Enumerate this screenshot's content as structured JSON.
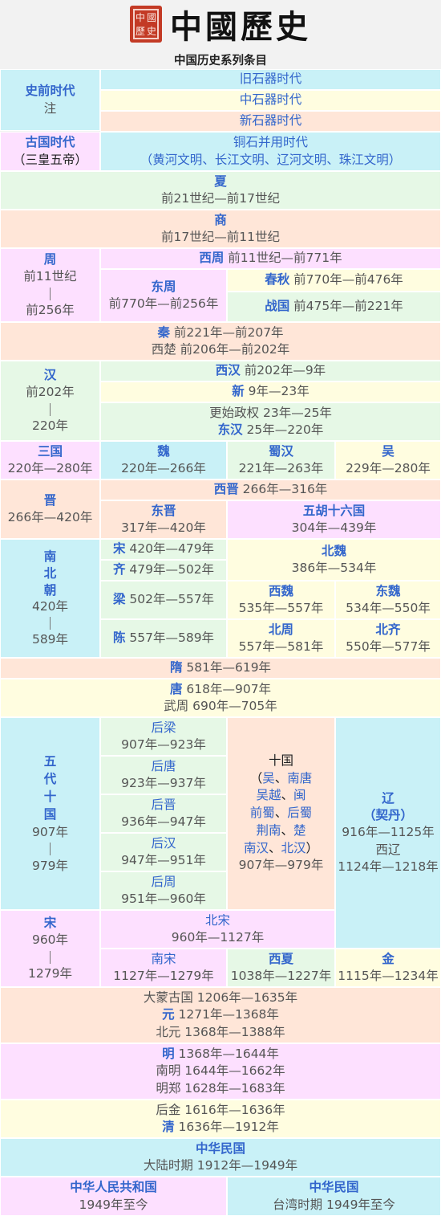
{
  "title": "中國歷史",
  "seal": [
    "中",
    "國",
    "歷",
    "史"
  ],
  "subtitle": "中国历史系列条目",
  "cells": {
    "c_prehist": [
      "史前时代",
      "注"
    ],
    "c_paleo": [
      "旧石器时代"
    ],
    "c_meso": [
      "中石器时代"
    ],
    "c_neo": [
      "新石器时代"
    ],
    "c_ancient": [
      "古国时代",
      "（三皇五帝）"
    ],
    "c_chalco": [
      "铜石并用时代",
      "（黄河文明、长江文明、辽河文明、珠江文明）"
    ],
    "c_xia": [
      "夏",
      "前21世纪—前17世纪"
    ],
    "c_shang": [
      "商",
      "前17世纪—前11世纪"
    ],
    "c_zhou": [
      "周",
      "前11世纪",
      "前256年"
    ],
    "c_xizhou": [
      "西周",
      " 前11世纪—前771年"
    ],
    "c_dongzhou": [
      "东周",
      "前770年—前256年"
    ],
    "c_chunqiu": [
      "春秋",
      " 前770年—前476年"
    ],
    "c_zhanguo": [
      "战国",
      " 前475年—前221年"
    ],
    "c_qin": [
      "秦",
      " 前221年—前207年",
      "西楚 前206年—前202年"
    ],
    "c_han": [
      "汉",
      "前202年",
      "220年"
    ],
    "c_xihan": [
      "西汉",
      " 前202年—9年"
    ],
    "c_xin": [
      "新",
      " 9年—23年"
    ],
    "c_gengshi": [
      "更始政权 23年—25年"
    ],
    "c_donghan": [
      "东汉",
      " 25年—220年"
    ],
    "c_sanguo": [
      "三国",
      "220年—280年"
    ],
    "c_wei": [
      "魏",
      "220年—266年"
    ],
    "c_shuhan": [
      "蜀汉",
      "221年—263年"
    ],
    "c_wu": [
      "吴",
      "229年—280年"
    ],
    "c_jin": [
      "晋",
      "266年—420年"
    ],
    "c_xijin": [
      "西晋",
      " 266年—316年"
    ],
    "c_dongjin": [
      "东晋",
      "317年—420年"
    ],
    "c_wuhu": [
      "五胡十六国",
      "304年—439年"
    ],
    "c_nanbei": [
      "南",
      "北",
      "朝",
      "420年",
      "589年"
    ],
    "c_song420": [
      "宋",
      " 420年—479年"
    ],
    "c_qi479": [
      "齐",
      " 479年—502年"
    ],
    "c_liang502": [
      "梁",
      " 502年—557年"
    ],
    "c_chen557": [
      "陈",
      " 557年—589年"
    ],
    "c_beiwei": [
      "北魏",
      "386年—534年"
    ],
    "c_xiwei": [
      "西魏",
      "535年—557年"
    ],
    "c_dongwei": [
      "东魏",
      "534年—550年"
    ],
    "c_beizhou": [
      "北周",
      "557年—581年"
    ],
    "c_beiqi": [
      "北齐",
      "550年—577年"
    ],
    "c_sui": [
      "隋",
      " 581年—619年"
    ],
    "c_tang": [
      "唐",
      " 618年—907年",
      "武周 690年—705年"
    ],
    "c_wudai": [
      "五",
      "代",
      "十",
      "国",
      "907年",
      "979年"
    ],
    "c_houliang": [
      "后梁",
      "907年—923年"
    ],
    "c_houtang": [
      "后唐",
      "923年—937年"
    ],
    "c_houjin": [
      "后晋",
      "936年—947年"
    ],
    "c_houhan": [
      "后汉",
      "947年—951年"
    ],
    "c_houzhou": [
      "后周",
      "951年—960年"
    ],
    "c_shiguo": [
      "十国",
      "（",
      "吴",
      "、",
      "南唐",
      "吴越",
      "、",
      "闽",
      "前蜀",
      "、",
      "后蜀",
      "荆南",
      "、",
      "楚",
      "南汉",
      "、",
      "北汉",
      "）",
      "907年—979年"
    ],
    "c_liao": [
      "辽",
      "（契丹）",
      "916年—1125年",
      "西辽",
      "1124年—1218年"
    ],
    "c_song960": [
      "宋",
      "960年",
      "1279年"
    ],
    "c_beisong": [
      "北宋",
      "960年—1127年"
    ],
    "c_nansong": [
      "南宋",
      "1127年—1279年"
    ],
    "c_xixia": [
      "西夏",
      "1038年—1227年"
    ],
    "c_jin1115": [
      "金",
      "1115年—1234年"
    ],
    "c_yuan": [
      "大蒙古国 1206年—1635年",
      "元",
      " 1271年—1368年",
      "北元 1368年—1388年"
    ],
    "c_ming": [
      "明",
      " 1368年—1644年",
      "南明 1644年—1662年",
      "明郑 1628年—1683年"
    ],
    "c_qing": [
      "后金 1616年—1636年",
      "清",
      " 1636年—1912年"
    ],
    "c_roc": [
      "中华民国",
      "大陆时期 1912年—1949年"
    ],
    "c_prc": [
      "中华人民共和国",
      "1949年至今"
    ],
    "c_roc_tw": [
      "中华民国",
      "台湾时期 1949年至今"
    ]
  },
  "colors": {
    "blue": "#c9f1f7",
    "yellow": "#fffde0",
    "peach": "#ffe6d8",
    "pink": "#fde0ff",
    "green": "#e6f8e6",
    "link": "#3366cc",
    "seal": "#c33a25"
  }
}
